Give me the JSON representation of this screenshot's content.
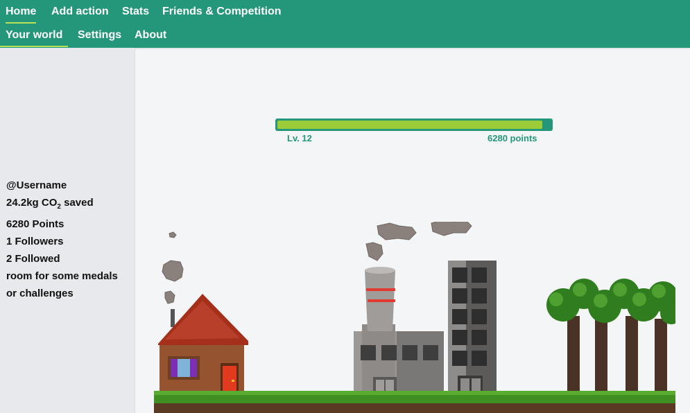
{
  "nav": {
    "primary": [
      "Home",
      "Add action",
      "Stats",
      "Friends & Competition"
    ],
    "secondary": [
      "Your world",
      "Settings",
      "About"
    ],
    "active_primary": "Home",
    "active_secondary": "Your world"
  },
  "profile": {
    "username": "@Username",
    "co2_amount": "24.2kg CO",
    "co2_sub": "2",
    "co2_suffix": " saved",
    "points": "6280 Points",
    "followers": "1 Followers",
    "followed": "2 Followed",
    "medals_line1": "room for some medals",
    "medals_line2": "or challenges"
  },
  "level": {
    "label": "Lv. 12",
    "points_label": "6280 points",
    "progress": 0.97
  },
  "colors": {
    "brand": "#24967a",
    "accent": "#9ccc37"
  },
  "icons": [
    "house",
    "factory",
    "apartment-building",
    "trees",
    "grass-ground",
    "smoke-clouds"
  ]
}
